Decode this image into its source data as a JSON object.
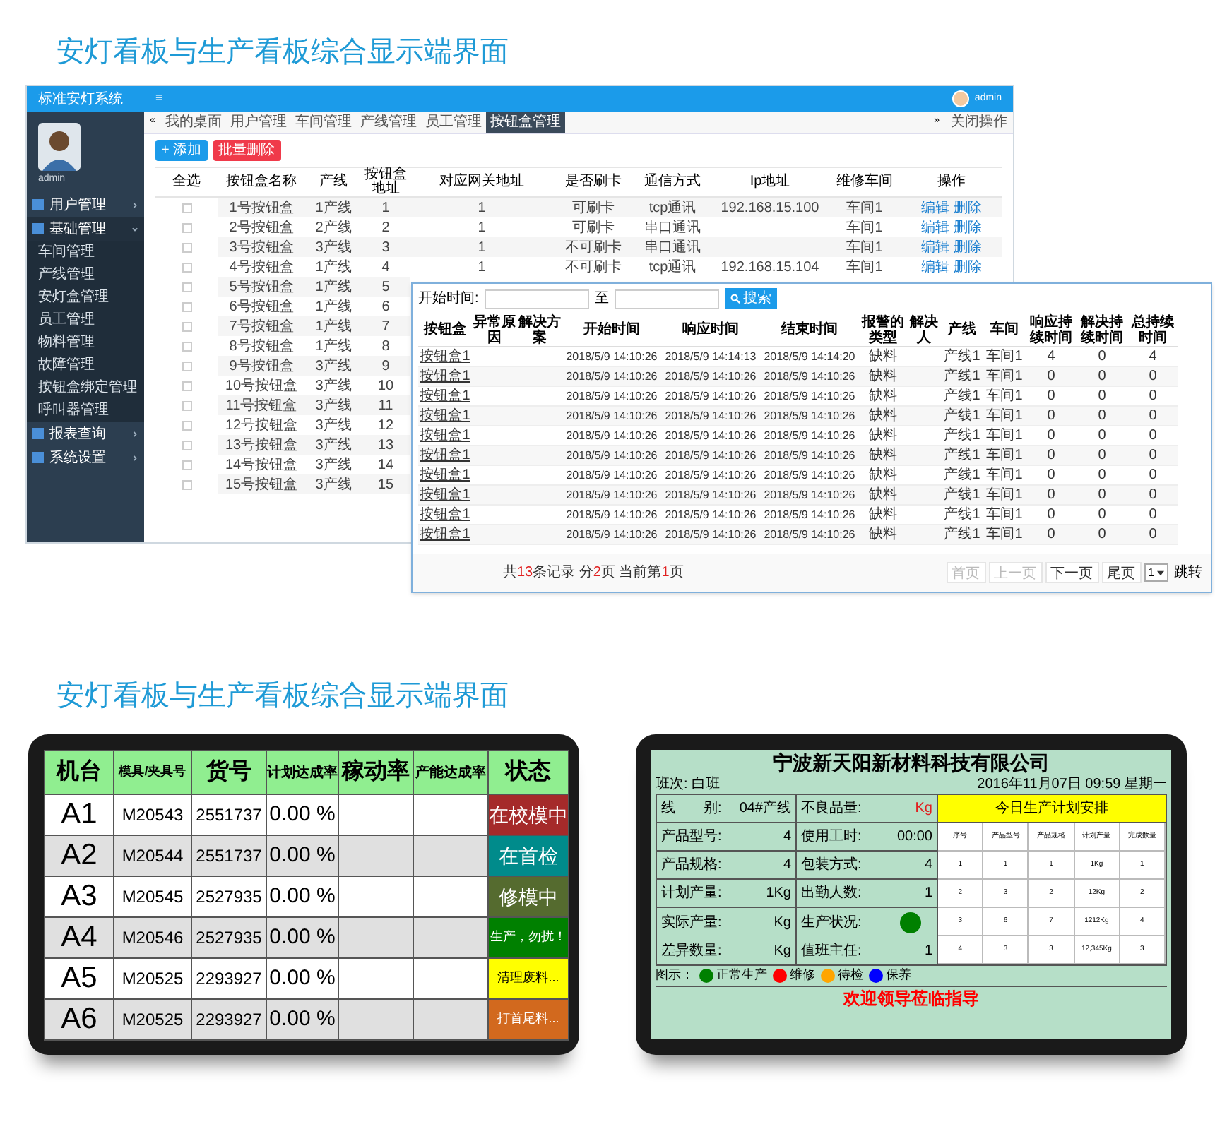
{
  "headings": [
    "安灯看板与生产看板综合显示端界面",
    "安灯看板与生产看板综合显示端界面"
  ],
  "admin": {
    "app_title": "标准安灯系统",
    "menu_toggle": "≡",
    "user": "admin",
    "profile_name": "admin",
    "sidebar": [
      {
        "label": "用户管理",
        "expanded": false
      },
      {
        "label": "基础管理",
        "expanded": true,
        "children": [
          {
            "label": "车间管理"
          },
          {
            "label": "产线管理"
          },
          {
            "label": "安灯盒管理"
          },
          {
            "label": "员工管理"
          },
          {
            "label": "物料管理"
          },
          {
            "label": "故障管理"
          },
          {
            "label": "按钮盒绑定管理"
          },
          {
            "label": "呼叫器管理"
          }
        ]
      },
      {
        "label": "报表查询",
        "expanded": false
      },
      {
        "label": "系统设置",
        "expanded": false
      }
    ],
    "tabs": [
      {
        "label": "我的桌面",
        "selected": false
      },
      {
        "label": "用户管理",
        "selected": false
      },
      {
        "label": "车间管理",
        "selected": false
      },
      {
        "label": "产线管理",
        "selected": false
      },
      {
        "label": "员工管理",
        "selected": false
      },
      {
        "label": "按钮盒管理",
        "selected": true
      }
    ],
    "tab_scroll_left": "«",
    "tab_scroll_right": "»",
    "close_menu": "关闭操作",
    "add_button": "+ 添加",
    "delete_button": "批量删除",
    "columns": [
      "全选",
      "按钮盒名称",
      "产线",
      "按钮盒地址",
      "对应网关地址",
      "是否刷卡",
      "通信方式",
      "Ip地址",
      "维修车间",
      "操作"
    ],
    "rows": [
      {
        "checked": false,
        "cells": [
          "",
          "1号按钮盒",
          "1产线",
          "1",
          "1",
          "可刷卡",
          "tcp通讯",
          "192.168.15.100",
          "车间1",
          "编辑 删除"
        ]
      },
      {
        "checked": false,
        "cells": [
          "",
          "2号按钮盒",
          "2产线",
          "2",
          "1",
          "可刷卡",
          "串口通讯",
          "",
          "车间1",
          "编辑 删除"
        ]
      },
      {
        "checked": false,
        "cells": [
          "",
          "3号按钮盒",
          "3产线",
          "3",
          "1",
          "不可刷卡",
          "串口通讯",
          "",
          "车间1",
          "编辑 删除"
        ]
      },
      {
        "checked": false,
        "cells": [
          "",
          "4号按钮盒",
          "1产线",
          "4",
          "1",
          "不可刷卡",
          "tcp通讯",
          "192.168.15.104",
          "车间1",
          "编辑 删除"
        ]
      },
      {
        "checked": false,
        "cells": [
          "",
          "5号按钮盒",
          "1产线",
          "5"
        ]
      },
      {
        "checked": false,
        "cells": [
          "",
          "6号按钮盒",
          "1产线",
          "6"
        ]
      },
      {
        "checked": false,
        "cells": [
          "",
          "7号按钮盒",
          "1产线",
          "7"
        ]
      },
      {
        "checked": false,
        "cells": [
          "",
          "8号按钮盒",
          "1产线",
          "8"
        ]
      },
      {
        "checked": false,
        "cells": [
          "",
          "9号按钮盒",
          "3产线",
          "9"
        ]
      },
      {
        "checked": false,
        "cells": [
          "",
          "10号按钮盒",
          "3产线",
          "10"
        ]
      },
      {
        "checked": false,
        "cells": [
          "",
          "11号按钮盒",
          "3产线",
          "11"
        ]
      },
      {
        "checked": false,
        "cells": [
          "",
          "12号按钮盒",
          "3产线",
          "12"
        ]
      },
      {
        "checked": false,
        "cells": [
          "",
          "13号按钮盒",
          "3产线",
          "13"
        ]
      },
      {
        "checked": false,
        "cells": [
          "",
          "14号按钮盒",
          "3产线",
          "14"
        ]
      },
      {
        "checked": false,
        "cells": [
          "",
          "15号按钮盒",
          "3产线",
          "15"
        ]
      }
    ]
  },
  "report": {
    "start_label": "开始时间:",
    "to_label": "至",
    "search_button": "搜索",
    "columns": [
      "按钮盒",
      "异常原因",
      "解决方案",
      "开始时间",
      "响应时间",
      "结束时间",
      "报警的类型",
      "解决人",
      "产线",
      "车间",
      "响应持续时间",
      "解决持续时间",
      "总持续时间"
    ],
    "rows": [
      [
        "按钮盒1",
        "",
        "",
        "2018/5/9 14:10:26",
        "2018/5/9 14:14:13",
        "2018/5/9 14:14:20",
        "缺料",
        "",
        "产线1",
        "车间1",
        "4",
        "0",
        "4"
      ],
      [
        "按钮盒1",
        "",
        "",
        "2018/5/9 14:10:26",
        "2018/5/9 14:10:26",
        "2018/5/9 14:10:26",
        "缺料",
        "",
        "产线1",
        "车间1",
        "0",
        "0",
        "0"
      ],
      [
        "按钮盒1",
        "",
        "",
        "2018/5/9 14:10:26",
        "2018/5/9 14:10:26",
        "2018/5/9 14:10:26",
        "缺料",
        "",
        "产线1",
        "车间1",
        "0",
        "0",
        "0"
      ],
      [
        "按钮盒1",
        "",
        "",
        "2018/5/9 14:10:26",
        "2018/5/9 14:10:26",
        "2018/5/9 14:10:26",
        "缺料",
        "",
        "产线1",
        "车间1",
        "0",
        "0",
        "0"
      ],
      [
        "按钮盒1",
        "",
        "",
        "2018/5/9 14:10:26",
        "2018/5/9 14:10:26",
        "2018/5/9 14:10:26",
        "缺料",
        "",
        "产线1",
        "车间1",
        "0",
        "0",
        "0"
      ],
      [
        "按钮盒1",
        "",
        "",
        "2018/5/9 14:10:26",
        "2018/5/9 14:10:26",
        "2018/5/9 14:10:26",
        "缺料",
        "",
        "产线1",
        "车间1",
        "0",
        "0",
        "0"
      ],
      [
        "按钮盒1",
        "",
        "",
        "2018/5/9 14:10:26",
        "2018/5/9 14:10:26",
        "2018/5/9 14:10:26",
        "缺料",
        "",
        "产线1",
        "车间1",
        "0",
        "0",
        "0"
      ],
      [
        "按钮盒1",
        "",
        "",
        "2018/5/9 14:10:26",
        "2018/5/9 14:10:26",
        "2018/5/9 14:10:26",
        "缺料",
        "",
        "产线1",
        "车间1",
        "0",
        "0",
        "0"
      ],
      [
        "按钮盒1",
        "",
        "",
        "2018/5/9 14:10:26",
        "2018/5/9 14:10:26",
        "2018/5/9 14:10:26",
        "缺料",
        "",
        "产线1",
        "车间1",
        "0",
        "0",
        "0"
      ],
      [
        "按钮盒1",
        "",
        "",
        "2018/5/9 14:10:26",
        "2018/5/9 14:10:26",
        "2018/5/9 14:10:26",
        "缺料",
        "",
        "产线1",
        "车间1",
        "0",
        "0",
        "0"
      ]
    ],
    "summary": [
      {
        "text": "共",
        "highlight": false
      },
      {
        "text": "13",
        "highlight": true
      },
      {
        "text": "条记录 分",
        "highlight": false
      },
      {
        "text": "2",
        "highlight": true
      },
      {
        "text": "页 当前第",
        "highlight": false
      },
      {
        "text": "1",
        "highlight": true
      },
      {
        "text": "页",
        "highlight": false
      }
    ],
    "pager": [
      {
        "label": "首页",
        "disabled": true
      },
      {
        "label": "上一页",
        "disabled": true
      },
      {
        "label": "下一页",
        "disabled": false
      },
      {
        "label": "尾页",
        "disabled": false
      }
    ],
    "page_select": "1",
    "jump_button": "跳转"
  },
  "andon": {
    "columns": [
      "机台",
      "模具/夹具号",
      "货号",
      "计划达成率",
      "稼动率",
      "产能达成率",
      "状态"
    ],
    "rows": [
      {
        "machine": "A1",
        "mold": "M20543",
        "item": "2551737",
        "plan_rate": "0.00 %",
        "status": "在校模中",
        "color": "#a52a2a"
      },
      {
        "machine": "A2",
        "mold": "M20544",
        "item": "2551737",
        "plan_rate": "0.00 %",
        "status": "在首检",
        "color": "#008b8b"
      },
      {
        "machine": "A3",
        "mold": "M20545",
        "item": "2527935",
        "plan_rate": "0.00 %",
        "status": "修模中",
        "color": "#556b2f"
      },
      {
        "machine": "A4",
        "mold": "M20546",
        "item": "2527935",
        "plan_rate": "0.00 %",
        "status": "生产，勿扰！",
        "color": "#008000"
      },
      {
        "machine": "A5",
        "mold": "M20525",
        "item": "2293927",
        "plan_rate": "0.00 %",
        "status": "清理废料...",
        "color": "#ffff00"
      },
      {
        "machine": "A6",
        "mold": "M20525",
        "item": "2293927",
        "plan_rate": "0.00 %",
        "status": "打首尾料...",
        "color": "#d2691e"
      }
    ]
  },
  "production": {
    "company": "宁波新天阳新材料科技有限公司",
    "shift": "班次: 白班",
    "datetime": "2016年11月07日 09:59 星期一",
    "left_fields": [
      {
        "label": "线　　别:",
        "value": "04#产线"
      },
      {
        "label": "产品型号:",
        "value": "4"
      },
      {
        "label": "产品规格:",
        "value": "4"
      },
      {
        "label": "计划产量:",
        "value": "1Kg"
      },
      {
        "label": "实际产量:",
        "value": "Kg"
      },
      {
        "label": "差异数量:",
        "value": "Kg"
      }
    ],
    "mid_fields": [
      {
        "label": "不良品量:",
        "kind": "text",
        "value": "Kg",
        "alert": true
      },
      {
        "label": "使用工时:",
        "kind": "text",
        "value": "00:00",
        "alert": false
      },
      {
        "label": "包装方式:",
        "kind": "text",
        "value": "4",
        "alert": false
      },
      {
        "label": "出勤人数:",
        "kind": "text",
        "value": "1",
        "alert": false
      },
      {
        "label": "生产状况:",
        "kind": "dot",
        "color": "#008000"
      },
      {
        "label": "值班主任:",
        "kind": "text",
        "value": "1",
        "alert": false
      }
    ],
    "plan_title": "今日生产计划安排",
    "plan_columns": [
      "序号",
      "产品型号",
      "产品规格",
      "计划产量",
      "完成数量"
    ],
    "plan_rows": [
      [
        "1",
        "1",
        "1",
        "1Kg",
        "1"
      ],
      [
        "2",
        "3",
        "2",
        "12Kg",
        "2"
      ],
      [
        "3",
        "6",
        "7",
        "1212Kg",
        "4"
      ],
      [
        "4",
        "3",
        "3",
        "12,345Kg",
        "3"
      ]
    ],
    "legend_label": "图示：",
    "legend": [
      {
        "label": "正常生产",
        "color": "#008000"
      },
      {
        "label": "维修",
        "color": "#ff0000"
      },
      {
        "label": "待检",
        "color": "#ffa500"
      },
      {
        "label": "保养",
        "color": "#0000ff"
      }
    ],
    "banner": "欢迎领导莅临指导"
  }
}
